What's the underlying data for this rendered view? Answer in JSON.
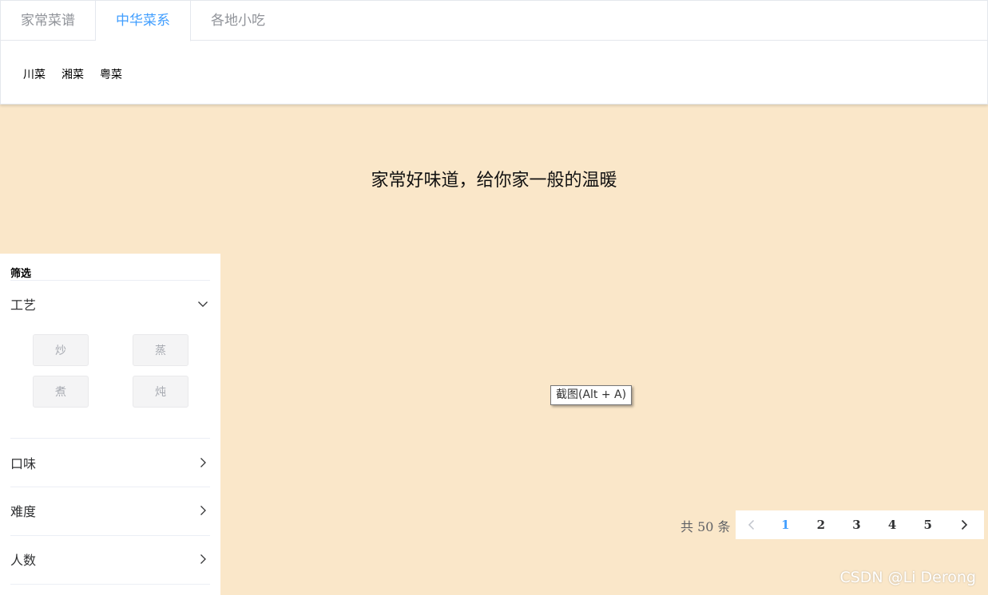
{
  "tabs": [
    {
      "label": "家常菜谱",
      "active": false
    },
    {
      "label": "中华菜系",
      "active": true
    },
    {
      "label": "各地小吃",
      "active": false
    }
  ],
  "sub_items": [
    "川菜",
    "湘菜",
    "粤菜"
  ],
  "slogan": "家常好味道，给你家一般的温暖",
  "filter": {
    "title": "筛选",
    "sections": [
      {
        "label": "工艺",
        "expanded": true,
        "options": [
          "炒",
          "蒸",
          "煮",
          "炖"
        ],
        "icon": "chevron-down-icon"
      },
      {
        "label": "口味",
        "expanded": false,
        "icon": "chevron-right-icon"
      },
      {
        "label": "难度",
        "expanded": false,
        "icon": "chevron-right-icon"
      },
      {
        "label": "人数",
        "expanded": false,
        "icon": "chevron-right-icon"
      }
    ]
  },
  "tooltip": "截图(Alt + A)",
  "pagination": {
    "total_text": "共 50 条",
    "pages": [
      "1",
      "2",
      "3",
      "4",
      "5"
    ],
    "current": "1"
  },
  "watermark": "CSDN @Li Derong",
  "colors": {
    "background": "#fae7c9",
    "accent": "#409eff"
  }
}
